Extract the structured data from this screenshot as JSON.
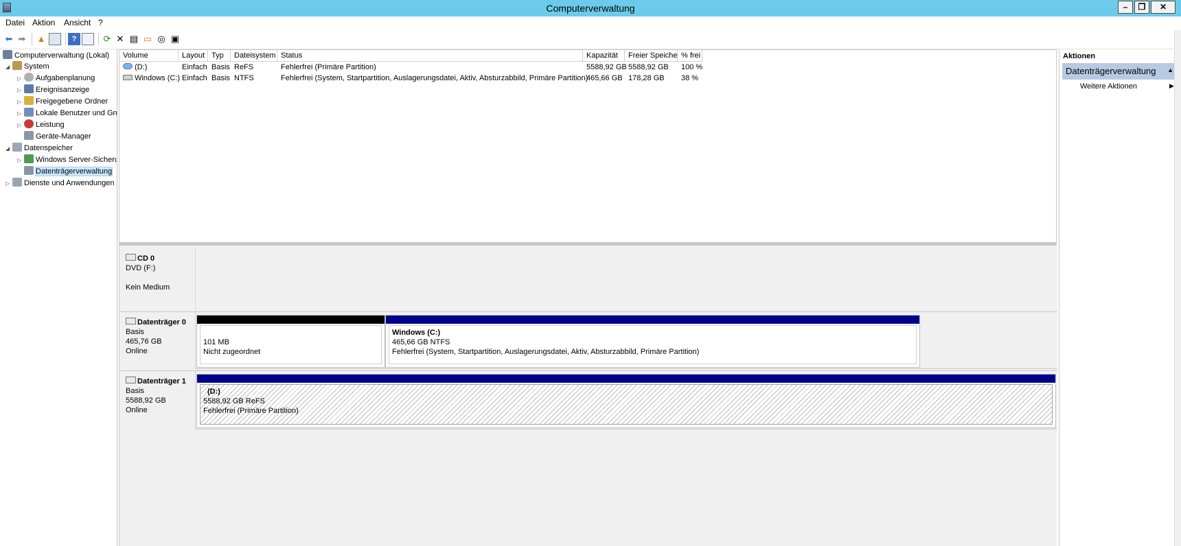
{
  "window": {
    "title": "Computerverwaltung"
  },
  "menu": [
    "Datei",
    "Aktion",
    "Ansicht",
    "?"
  ],
  "toolbar_icons": [
    "back-arrow-icon",
    "forward-arrow-icon",
    "up-folder-icon",
    "show-hide-tree-icon",
    "help-icon",
    "properties-panel-icon",
    "refresh-icon",
    "delete-icon",
    "properties-icon",
    "open-folder-icon",
    "search-disk-icon",
    "settings-icon"
  ],
  "tree": {
    "root": "Computerverwaltung (Lokal)",
    "system": "System",
    "aufgabenplanung": "Aufgabenplanung",
    "ereignisanzeige": "Ereignisanzeige",
    "freigegebene_ordner": "Freigegebene Ordner",
    "lokale_benutzer": "Lokale Benutzer und Gru",
    "leistung": "Leistung",
    "geraete_manager": "Geräte-Manager",
    "datenspeicher": "Datenspeicher",
    "server_sicherung": "Windows Server-Sicherung",
    "datentraegerverwaltung": "Datenträgerverwaltung",
    "dienste": "Dienste und Anwendungen"
  },
  "volume_table": {
    "headers": [
      "Volume",
      "Layout",
      "Typ",
      "Dateisystem",
      "Status",
      "Kapazität",
      "Freier Speicher",
      "% frei"
    ],
    "rows": [
      [
        "(D:)",
        "Einfach",
        "Basis",
        "ReFS",
        "Fehlerfrei (Primäre Partition)",
        "5588,92 GB",
        "5588,92 GB",
        "100 %"
      ],
      [
        "Windows (C:)",
        "Einfach",
        "Basis",
        "NTFS",
        "Fehlerfrei (System, Startpartition, Auslagerungsdatei, Aktiv, Absturzabbild, Primäre Partition)",
        "465,66 GB",
        "178,28 GB",
        "38 %"
      ]
    ]
  },
  "disks": {
    "cd0": {
      "name": "CD 0",
      "line1": "DVD (F:)",
      "line2": "Kein Medium"
    },
    "disk0": {
      "name": "Datenträger 0",
      "type": "Basis",
      "size": "465,76 GB",
      "state": "Online",
      "p1": {
        "size": "101 MB",
        "status": "Nicht zugeordnet"
      },
      "p2": {
        "title": "Windows  (C:)",
        "size": "465,66 GB NTFS",
        "status": "Fehlerfrei (System, Startpartition, Auslagerungsdatei, Aktiv, Absturzabbild, Primäre Partition)"
      }
    },
    "disk1": {
      "name": "Datenträger 1",
      "type": "Basis",
      "size": "5588,92 GB",
      "state": "Online",
      "p1": {
        "title": "(D:)",
        "size": "5588,92 GB ReFS",
        "status": "Fehlerfrei (Primäre Partition)"
      }
    }
  },
  "actions": {
    "title": "Aktionen",
    "section": "Datenträgerverwaltung",
    "item": "Weitere Aktionen"
  },
  "colors": {
    "titlebar": "#6ccbea",
    "primary_partition": "#00008b",
    "unallocated": "#000000",
    "actions_header": "#b7cae3"
  }
}
